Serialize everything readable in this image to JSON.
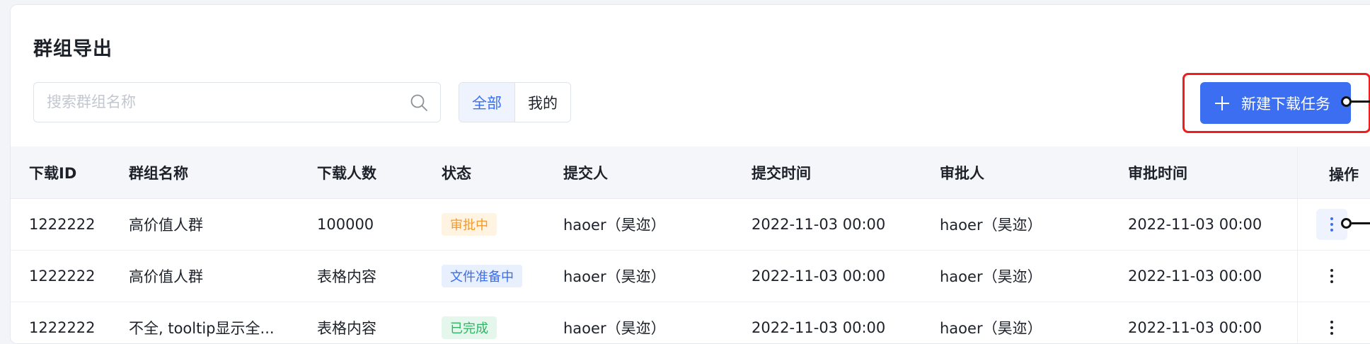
{
  "page": {
    "title": "群组导出"
  },
  "search": {
    "placeholder": "搜索群组名称",
    "value": ""
  },
  "filter": {
    "options": [
      "全部",
      "我的"
    ],
    "selected": "全部"
  },
  "actions": {
    "new_task_label": "新建下载任务"
  },
  "table": {
    "columns": [
      "下载ID",
      "群组名称",
      "下载人数",
      "状态",
      "提交人",
      "提交时间",
      "审批人",
      "审批时间",
      "操作"
    ],
    "rows": [
      {
        "id": "1222222",
        "group": "高价值人群",
        "count": "100000",
        "status": "审批中",
        "status_type": "pending",
        "submitter": "haoer（昊迩）",
        "submit_time": "2022-11-03 00:00",
        "approver": "haoer（昊迩）",
        "approve_time": "2022-11-03 00:00"
      },
      {
        "id": "1222222",
        "group": "高价值人群",
        "count": "表格内容",
        "status": "文件准备中",
        "status_type": "preparing",
        "submitter": "haoer（昊迩）",
        "submit_time": "2022-11-03 00:00",
        "approver": "haoer（昊迩）",
        "approve_time": "2022-11-03 00:00"
      },
      {
        "id": "1222222",
        "group": "不全, tooltip显示全...",
        "count": "表格内容",
        "status": "已完成",
        "status_type": "done",
        "submitter": "haoer（昊迩）",
        "submit_time": "2022-11-03 00:00",
        "approver": "haoer（昊迩）",
        "approve_time": "2022-11-03 00:00"
      }
    ]
  },
  "colors": {
    "primary": "#3c6ef2",
    "annotation_red": "#f01d1d",
    "pending": "#f29a2e",
    "preparing": "#3a6ef0",
    "done": "#2fb463"
  }
}
